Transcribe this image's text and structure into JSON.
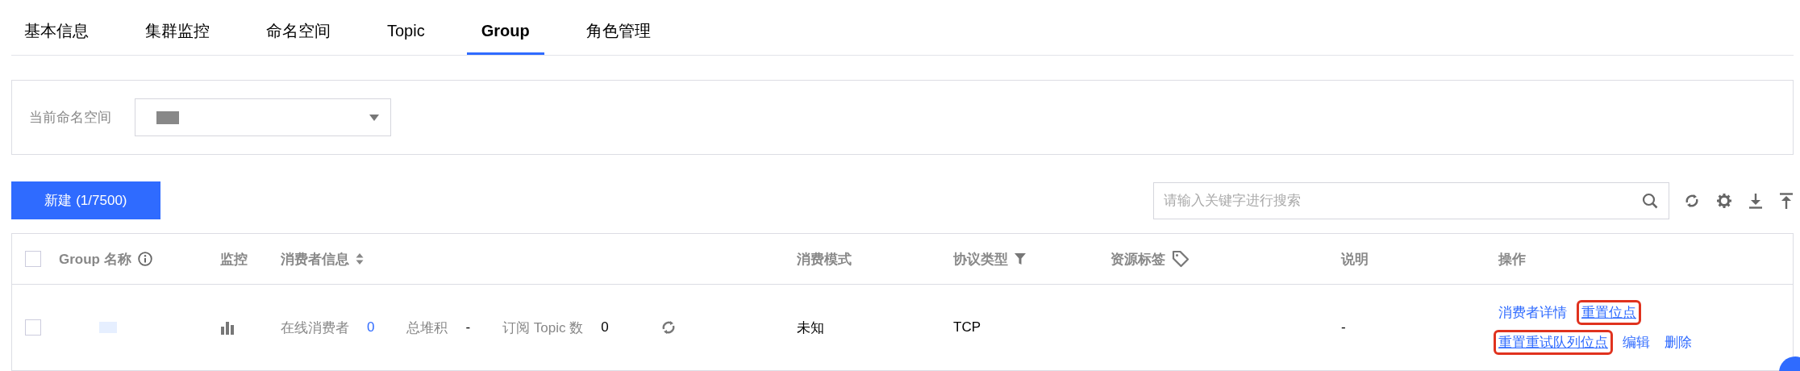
{
  "tabs": [
    {
      "label": "基本信息",
      "selected": false
    },
    {
      "label": "集群监控",
      "selected": false
    },
    {
      "label": "命名空间",
      "selected": false
    },
    {
      "label": "Topic",
      "selected": false
    },
    {
      "label": "Group",
      "selected": true
    },
    {
      "label": "角色管理",
      "selected": false
    }
  ],
  "filter": {
    "label": "当前命名空间"
  },
  "toolbar": {
    "create_button": "新建 (1/7500)",
    "search": {
      "placeholder": "请输入关键字进行搜索"
    }
  },
  "table": {
    "header_checked": false,
    "columns": [
      {
        "label": "Group 名称"
      },
      {
        "label": "监控"
      },
      {
        "label": "消费者信息"
      },
      {
        "label": "消费模式"
      },
      {
        "label": "协议类型"
      },
      {
        "label": "资源标签"
      },
      {
        "label": "说明"
      },
      {
        "label": "操作"
      }
    ],
    "rows": [
      {
        "checked": false,
        "online_label": "在线消费者",
        "online_count": "0",
        "backlog_label": "总堆积",
        "backlog": "-",
        "topics_label": "订阅 Topic 数",
        "topics": "0",
        "mode": "未知",
        "protocol": "TCP",
        "description": "-",
        "actions": [
          [
            {
              "label": "消费者详情",
              "highlighted": false
            },
            {
              "label": "重置位点",
              "highlighted": true
            }
          ],
          [
            {
              "label": "重置重试队列位点",
              "highlighted": true
            },
            {
              "label": "编辑",
              "highlighted": false
            },
            {
              "label": "删除",
              "highlighted": false
            }
          ]
        ]
      }
    ]
  }
}
